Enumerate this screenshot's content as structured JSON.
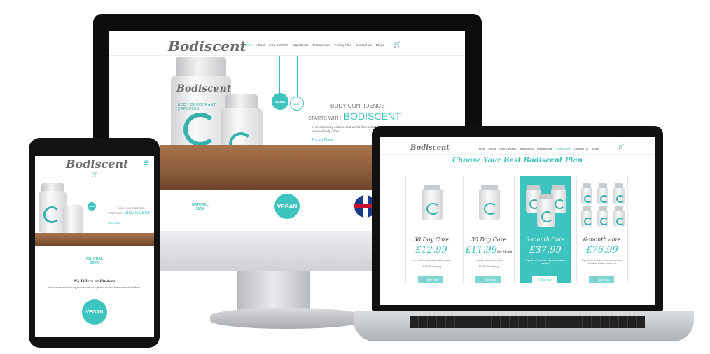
{
  "brand": {
    "logo": "Bodiscent",
    "accent": "#3ec4be"
  },
  "desktop": {
    "nav": [
      "Home",
      "How It Works",
      "Ingredients",
      "Testimonials",
      "Pricing Plan",
      "Contact Us",
      "Blogs"
    ],
    "nav_active": "Home",
    "hero_kicker": "BODY CONFIDENCE",
    "hero_starts": "STARTS WITH",
    "hero_brand": "BODISCENT",
    "hero_body": "A revolutionary solution that works from inside to remove body odour.",
    "hero_link": "Pricing Plans",
    "jar_label_brand": "Bodiscent",
    "jar_label_product": "BODY DEODORANT CAPSULES",
    "badge_vegan": "VEGAN",
    "badge_natural": "NATURAL",
    "badge_percent": "100%"
  },
  "tablet": {
    "hero_kicker": "BODY CONFIDENCE",
    "hero_starts": "STARTS WITH",
    "hero_brand": "BODISCENT",
    "hero_link": "Pricing Plans",
    "badge_natural": "NATURAL",
    "badge_percent": "100%",
    "no_fillers": "No Fillers or Binders",
    "no_fillers_body": "Bodiscent is a natural supplement without synthetic binders, fillers or harsh additives.",
    "badge_vegan": "VEGAN"
  },
  "laptop": {
    "nav": [
      "Home",
      "About",
      "How It Works",
      "Ingredients",
      "Testimonials",
      "Pricing Plan",
      "Contact Us",
      "Blogs"
    ],
    "nav_active": "Pricing Plan",
    "section_title": "Choose Your Best Bodiscent Plan",
    "plans": [
      {
        "title": "30 Day Care",
        "price": "£12.99",
        "per": "",
        "desc": "or try our monthly subscription plan.",
        "shipping": "£1.99 UK shipping",
        "button": "Buy Now",
        "featured": false
      },
      {
        "title": "30 Day Care",
        "price": "£11.99",
        "per": "Per Month",
        "desc": "monthly subscription plan",
        "shipping": "£1.99 UK shipping",
        "button": "Buy Now",
        "featured": false
      },
      {
        "title": "3-month Care",
        "price": "£37.99",
        "per": "",
        "desc": "Try out our 3-month plan and make a saving!",
        "shipping": "",
        "button": "Buy Now",
        "featured": true
      },
      {
        "title": "6-month care",
        "price": "£76.99",
        "per": "",
        "desc": "Try out our 6-month care plan and get 6 bottles for the price of 5!",
        "shipping": "",
        "button": "Buy Now",
        "featured": false
      }
    ]
  }
}
